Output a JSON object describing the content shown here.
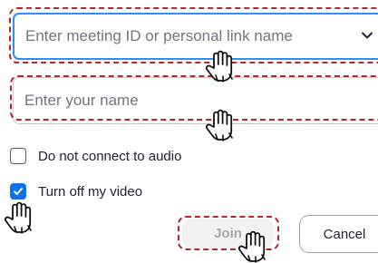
{
  "meeting_field": {
    "placeholder": "Enter meeting ID or personal link name",
    "dropdown_icon": "chevron-down-icon"
  },
  "name_field": {
    "placeholder": "Enter your name"
  },
  "options": [
    {
      "label": "Do not connect to audio",
      "checked": false
    },
    {
      "label": "Turn off my video",
      "checked": true
    }
  ],
  "buttons": {
    "join_label": "Join",
    "join_enabled": false,
    "cancel_label": "Cancel"
  },
  "colors": {
    "accent": "#0e72ed",
    "focus_border": "#2d8cff",
    "annotation": "#b8262b"
  },
  "annotations": {
    "pointer_icon": "hand-pointer-icon"
  }
}
